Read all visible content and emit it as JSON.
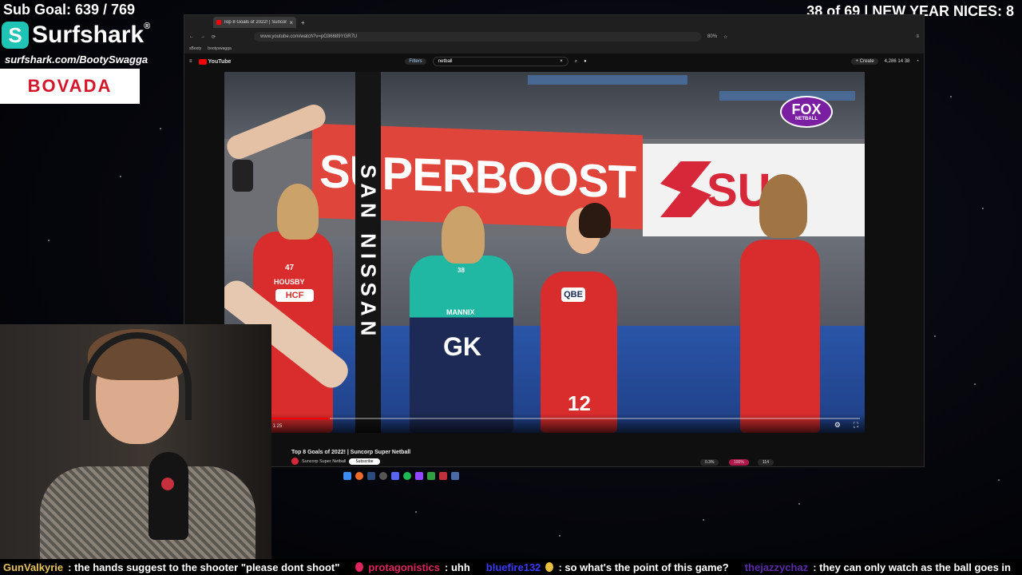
{
  "overlay": {
    "sub_goal": "Sub Goal: 639 / 769",
    "counter": "38 of 69 | NEW YEAR NICES: 8",
    "surfshark_name": "Surfshark",
    "surfshark_reg": "®",
    "surfshark_url": "surfshark.com/BootySwagga",
    "bovada": "BOVADA"
  },
  "browser": {
    "tab_title": "Top 8 Goals of 2022! | Suncorp S",
    "tab_close": "×",
    "tab_new": "+",
    "url": "www.youtube.com/watch?v=pO36689YGR7U",
    "zoom": "80%",
    "bookmarks": [
      "sBooty",
      "bootyswagga"
    ],
    "yt_brand": "YouTube",
    "filters_label": "Filters",
    "search_value": "netball",
    "search_clear": "×",
    "create_label": "+ Create",
    "header_stats": "4,286  14  38"
  },
  "video": {
    "banner_red_text": "SUPERBOOST",
    "banner_white_text": "SU",
    "post_text": "SAN NISSAN",
    "fox_word": "FOX",
    "fox_sub": "NETBALL",
    "player_left_name": "HOUSBY",
    "player_left_number": "47",
    "player_left_sponsor": "HCF",
    "player_center_name": "MANNIX",
    "player_center_bib": "GK",
    "player_center_number": "38",
    "player_right_bib": "QBE",
    "player_right_number": "12",
    "time": "0:12 / 1:25",
    "progress": 0.16
  },
  "below": {
    "title": "Top 8 Goals of 2022! | Suncorp Super Netball",
    "channel": "Suncorp Super Netball",
    "subscribe": "Subscribe",
    "stat_a": "0.3%",
    "stat_b": "100%",
    "stat_c": "114"
  },
  "chat": [
    {
      "user": "GunValkyrie",
      "color": "#e6c35c",
      "text": ": the hands suggest to the shooter \"please dont shoot\""
    },
    {
      "user": "protagonistics",
      "color": "#e0245e",
      "text": ": uhh"
    },
    {
      "user": "bluefire132",
      "color": "#3b3bff",
      "text": ": so what's the point of this game?"
    },
    {
      "user": "thejazzychaz",
      "color": "#5b2ca8",
      "text": ": they can only watch as the ball goes in"
    }
  ],
  "colors": {
    "accent_red": "#ff0000",
    "surfshark_teal": "#1fc4b4",
    "bovada_red": "#d3162a"
  }
}
